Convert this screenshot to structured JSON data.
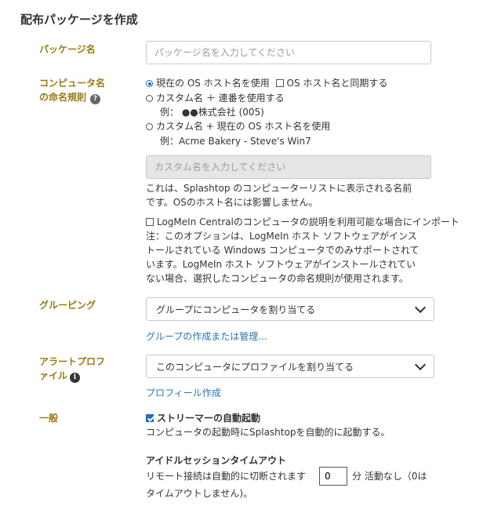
{
  "page": {
    "title": "配布パッケージを作成"
  },
  "package_name": {
    "label": "パッケージ名",
    "placeholder": "パッケージ名を入力してください"
  },
  "naming": {
    "label_line1": "コンピュータ名",
    "label_line2": "の命名規則",
    "help_icon": "?",
    "option1": "現在の OS ホスト名を使用",
    "sync_checkbox": "OS ホスト名と同期する",
    "option2": "カスタム名 ＋ 連番を使用する",
    "option2_example": "例： ●●株式会社 (005)",
    "option3": "カスタム名 + 現在の OS ホスト名を使用",
    "option3_example": "例：Acme Bakery - Steve's Win7",
    "custom_placeholder": "カスタム名を入力してください",
    "desc_line1": "これは、Splashtop のコンピューターリストに表示される名前",
    "desc_line2": "です。OSのホスト名には影響しません。",
    "logmein_checkbox": "LogMeIn Centralのコンピュータの説明を利用可能な場合にインポート",
    "note_line1": "注：このオプションは、LogMeIn ホスト ソフトウェアがインス",
    "note_line2": "トールされている Windows コンピュータでのみサポートされて",
    "note_line3": "います。LogMeIn ホスト ソフトウェアがインストールされてい",
    "note_line4": "ない場合、選択したコンピュータの命名規則が使用されます。"
  },
  "grouping": {
    "label": "グルーピング",
    "selected": "グループにコンピュータを割り当てる",
    "link": "グループの作成または管理..."
  },
  "alert": {
    "label_line1": "アラートプロフ",
    "label_line2": "ァイル",
    "info_icon": "i",
    "selected": "このコンピュータにプロファイルを割り当てる",
    "link": "プロフィール作成"
  },
  "general": {
    "label": "一般",
    "autostart_label": "ストリーマーの自動起動",
    "autostart_desc": "コンピュータの起動時にSplashtopを自動的に起動する。",
    "idle_title": "アイドルセッションタイムアウト",
    "idle_prefix": "リモート接続は自動的に切断されます",
    "idle_value": "0",
    "idle_suffix": "分 活動なし（0は",
    "idle_line2": "タイムアウトしません)。"
  },
  "colors": {
    "label": "#9a7a14",
    "link": "#2a74b5",
    "accent": "#1a6fc4"
  }
}
